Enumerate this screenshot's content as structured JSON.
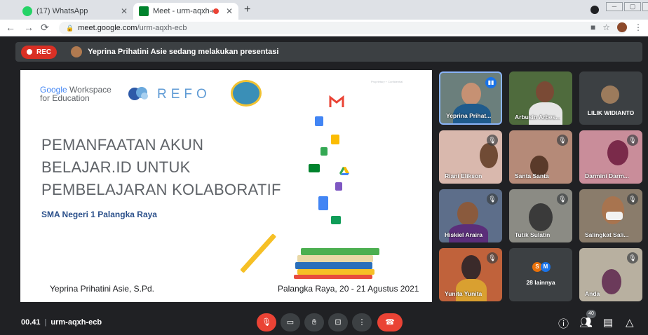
{
  "browser": {
    "tabs": [
      {
        "title": "(17) WhatsApp",
        "active": false
      },
      {
        "title": "Meet - urm-aqxh-ecb",
        "active": true
      }
    ],
    "url_host": "meet.google.com",
    "url_path": "/urm-aqxh-ecb"
  },
  "meet": {
    "rec_label": "REC",
    "presenting_text": "Yeprina Prihatini Asie sedang melakukan presentasi",
    "time": "00.41",
    "meeting_code": "urm-aqxh-ecb",
    "participant_count": "40"
  },
  "slide": {
    "gw_line1": [
      "Google",
      " Workspace"
    ],
    "gw_line2": "for Education",
    "refo": "REFO",
    "confidential": "Proprietary + Confidential",
    "title_lines": [
      "PEMANFAATAN AKUN",
      "BELAJAR.ID UNTUK",
      "PEMBELAJARAN KOLABORATIF"
    ],
    "subtitle": "SMA Negeri 1 Palangka Raya",
    "presenter_name": "Yeprina Prihatini Asie, S.Pd.",
    "place_date": "Palangka Raya, 20 - 21 Agustus 2021"
  },
  "participants": [
    {
      "name": "Yeprina Prihat...",
      "state": "speaking"
    },
    {
      "name": "Arbusin Arbes...",
      "state": "normal"
    },
    {
      "name": "LILIK WIDIANTO",
      "state": "avatar"
    },
    {
      "name": "Riani Elikson",
      "state": "muted"
    },
    {
      "name": "Santa Santa",
      "state": "muted"
    },
    {
      "name": "Darmini Darm...",
      "state": "muted"
    },
    {
      "name": "Hiskiel Araira",
      "state": "muted"
    },
    {
      "name": "Tutik Sulatin",
      "state": "muted"
    },
    {
      "name": "Salingkat Sali...",
      "state": "muted"
    },
    {
      "name": "Yunita Yunita",
      "state": "muted"
    },
    {
      "name": "28 lainnya",
      "state": "others",
      "initials": [
        "S",
        "M"
      ]
    },
    {
      "name": "Anda",
      "state": "muted"
    }
  ],
  "colors": {
    "meet_bg": "#202124",
    "tile_bg": "#3c4043",
    "rec_red": "#d93025",
    "end_call_red": "#ea4335",
    "accent_blue": "#1a73e8"
  },
  "icons": {
    "mic": "mic-off-icon",
    "camera": "camera-icon",
    "hand": "raise-hand-icon",
    "present": "present-icon",
    "more": "more-options-icon",
    "end": "end-call-icon",
    "info": "info-icon",
    "people": "people-icon",
    "chat": "chat-icon",
    "activities": "activities-icon"
  }
}
